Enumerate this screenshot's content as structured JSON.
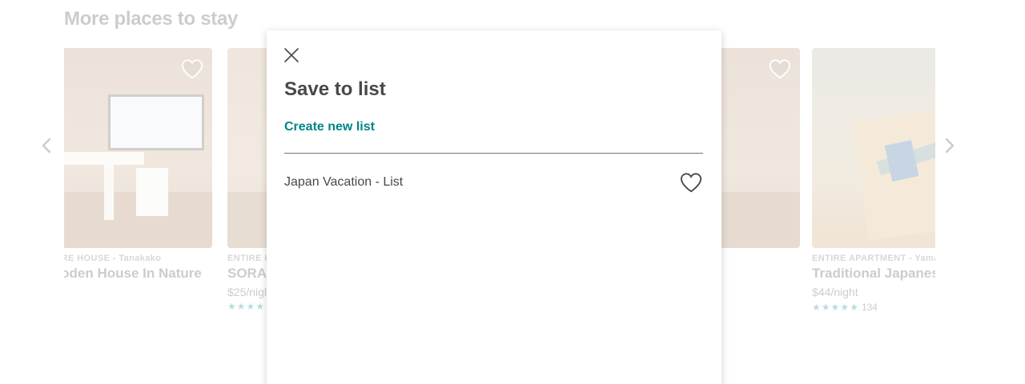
{
  "page": {
    "section_title": "More places to stay",
    "prev_icon": "chevron-left-icon",
    "next_icon": "chevron-right-icon"
  },
  "cards": [
    {
      "kicker": "ENTIRE HOUSE - Tanakako",
      "name": "Wooden House In Nature",
      "price": "",
      "rating_stars": 0,
      "reviews": "",
      "saved_icon": "heart-outline-icon"
    },
    {
      "kicker": "ENTIRE HOUSE",
      "name": "SORA",
      "price": "$25/night",
      "rating_stars": 5,
      "reviews": "",
      "saved_icon": "heart-outline-icon"
    },
    {
      "kicker": "",
      "name": "",
      "price": "",
      "rating_stars": 0,
      "reviews": "",
      "saved_icon": "heart-outline-icon"
    },
    {
      "kicker": "ENTIRE APARTMENT - Yamanashi",
      "name": "Traditional Japanese House",
      "price": "$44/night",
      "rating_stars": 5,
      "reviews": "134",
      "saved_icon": "heart-outline-icon"
    }
  ],
  "modal": {
    "close_icon": "close-icon",
    "title": "Save to list",
    "create_link": "Create new list",
    "lists": [
      {
        "name": "Japan Vacation - List",
        "icon": "heart-outline-icon"
      }
    ]
  },
  "colors": {
    "accent": "#008489",
    "text": "#484848",
    "divider": "#757575"
  }
}
